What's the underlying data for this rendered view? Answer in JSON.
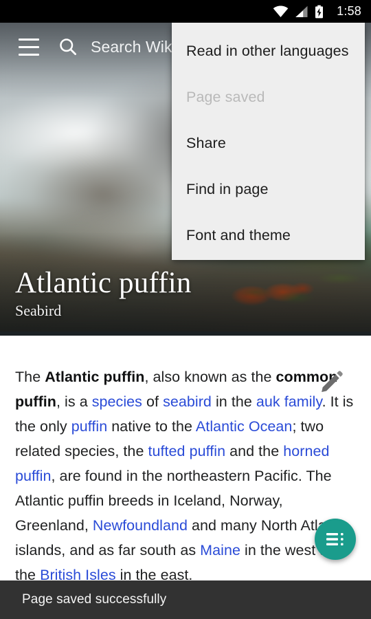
{
  "status_bar": {
    "time": "1:58",
    "icons": [
      "wifi-icon",
      "cell-signal-icon",
      "battery-charging-icon"
    ]
  },
  "toolbar": {
    "menu_icon": "hamburger-menu-icon",
    "search_icon": "search-icon",
    "search_placeholder": "Search Wikipedia",
    "search_value": "Search Wik"
  },
  "hero": {
    "title": "Atlantic puffin",
    "subtitle": "Seabird",
    "image_description": "blurred rocky coastline with teal water and orange puffin feet on grass"
  },
  "overflow_menu": {
    "items": [
      {
        "label": "Read in other languages",
        "enabled": true
      },
      {
        "label": "Page saved",
        "enabled": false
      },
      {
        "label": "Share",
        "enabled": true
      },
      {
        "label": "Find in page",
        "enabled": true
      },
      {
        "label": "Font and theme",
        "enabled": true
      }
    ]
  },
  "article": {
    "edit_icon": "pencil-edit-icon",
    "paragraph_parts": [
      {
        "text": "The ",
        "style": "plain"
      },
      {
        "text": "Atlantic puffin",
        "style": "bold"
      },
      {
        "text": ", also known as the ",
        "style": "plain"
      },
      {
        "text": "common puffin",
        "style": "bold"
      },
      {
        "text": ", is a ",
        "style": "plain"
      },
      {
        "text": "species",
        "style": "link"
      },
      {
        "text": " of ",
        "style": "plain"
      },
      {
        "text": "seabird",
        "style": "link"
      },
      {
        "text": " in the ",
        "style": "plain"
      },
      {
        "text": "auk family",
        "style": "link"
      },
      {
        "text": ". It is the only ",
        "style": "plain"
      },
      {
        "text": "puffin",
        "style": "link"
      },
      {
        "text": " native to the ",
        "style": "plain"
      },
      {
        "text": "Atlantic Ocean",
        "style": "link"
      },
      {
        "text": "; two related species, the ",
        "style": "plain"
      },
      {
        "text": "tufted puffin",
        "style": "link"
      },
      {
        "text": " and the ",
        "style": "plain"
      },
      {
        "text": "horned puffin",
        "style": "link"
      },
      {
        "text": ", are found in the northeastern Pacific. The Atlantic puffin breeds in Iceland, Norway, Greenland, ",
        "style": "plain"
      },
      {
        "text": "Newfoundland",
        "style": "link"
      },
      {
        "text": " and many North Atlantic islands, and as far south as ",
        "style": "plain"
      },
      {
        "text": "Maine",
        "style": "link"
      },
      {
        "text": " in the west and the ",
        "style": "plain"
      },
      {
        "text": "British Isles",
        "style": "link"
      },
      {
        "text": " in the east.",
        "style": "plain"
      }
    ]
  },
  "fab": {
    "icon": "table-of-contents-icon"
  },
  "snackbar": {
    "message": "Page saved successfully"
  },
  "colors": {
    "fab_teal": "#1a9c8c",
    "link_blue": "#2a4bd7",
    "menu_background": "#eeeeee",
    "snackbar_background": "#323232",
    "status_bar_background": "#000000",
    "disabled_text": "#b9b9b9"
  }
}
